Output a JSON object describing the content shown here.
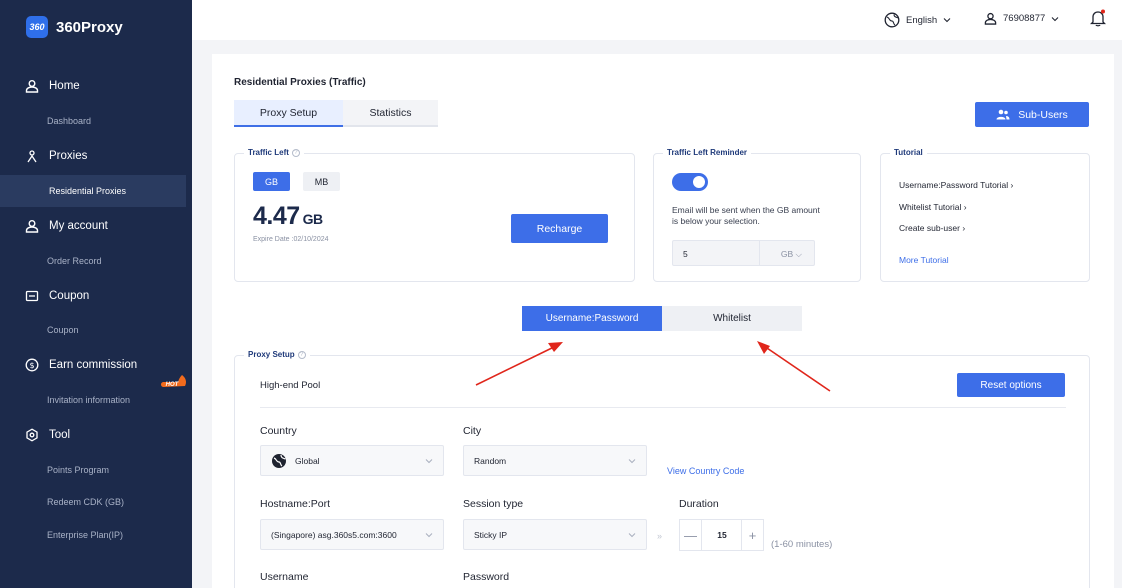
{
  "brand": {
    "name": "360Proxy",
    "logo_text": "360"
  },
  "sidebar": {
    "groups": [
      {
        "label": "Home",
        "icon": "user-icon",
        "subs": [
          "Dashboard"
        ]
      },
      {
        "label": "Proxies",
        "icon": "proxies-icon",
        "subs": [
          "Residential Proxies"
        ]
      },
      {
        "label": "My account",
        "icon": "user-icon",
        "subs": [
          "Order Record"
        ]
      },
      {
        "label": "Coupon",
        "icon": "coupon-icon",
        "subs": [
          "Coupon"
        ]
      },
      {
        "label": "Earn commission",
        "icon": "dollar-icon",
        "subs": [
          "Invitation information"
        ]
      },
      {
        "label": "Tool",
        "icon": "gear-icon",
        "subs": [
          "Points Program",
          "Redeem CDK (GB)",
          "Enterprise Plan(IP)"
        ]
      }
    ],
    "hot_badge": "HOT",
    "active_item": "Residential Proxies"
  },
  "topbar": {
    "language": "English",
    "user_id": "76908877"
  },
  "page": {
    "title": "Residential Proxies (Traffic)",
    "tabs": [
      "Proxy Setup",
      "Statistics"
    ],
    "sub_users_label": "Sub-Users"
  },
  "traffic": {
    "legend": "Traffic Left",
    "units": [
      "GB",
      "MB"
    ],
    "value": "4.47",
    "unit": "GB",
    "expire": "Expire Date :02/10/2024",
    "recharge_label": "Recharge"
  },
  "reminder": {
    "legend": "Traffic Left Reminder",
    "text": "Email will be sent when the GB amount is below your selection.",
    "value": "5",
    "unit": "GB",
    "enabled": true
  },
  "tutorial": {
    "legend": "Tutorial",
    "links": [
      "Username:Password Tutorial",
      "Whitelist Tutorial",
      "Create sub-user"
    ],
    "more": "More Tutorial"
  },
  "mode_tabs": [
    "Username:Password",
    "Whitelist"
  ],
  "setup": {
    "legend": "Proxy Setup",
    "pool": "High-end Pool",
    "reset_label": "Reset options",
    "country_label": "Country",
    "country_value": "Global",
    "city_label": "City",
    "city_value": "Random",
    "view_code": "View Country Code",
    "hostname_label": "Hostname:Port",
    "hostname_value": "(Singapore) asg.360s5.com:3600",
    "session_label": "Session type",
    "session_value": "Sticky IP",
    "duration_label": "Duration",
    "duration_value": "15",
    "duration_hint": "(1-60 minutes)",
    "username_label": "Username",
    "password_label": "Password"
  },
  "colors": {
    "sidebar": "#1c2a4b",
    "accent": "#3d6ee8",
    "hot": "#f26b1d",
    "annotation": "#e0261b"
  }
}
